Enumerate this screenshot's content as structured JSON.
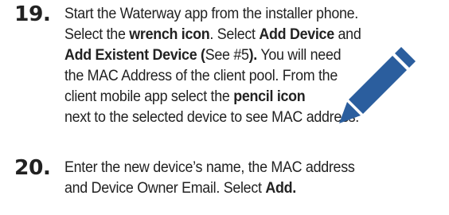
{
  "steps": [
    {
      "number": "19.",
      "lines": [
        [
          "Start the Waterway app from the installer phone."
        ],
        [
          "Select the ",
          "wrench icon",
          ". Select ",
          "Add Device",
          " and"
        ],
        [
          "Add Existent Device (",
          "See #5",
          ").",
          " You will need"
        ],
        [
          "the MAC Address of the client pool. From the"
        ],
        [
          "client mobile app select the ",
          "pencil icon"
        ],
        [
          "next to the selected device to see MAC address."
        ]
      ]
    },
    {
      "number": "20.",
      "lines": [
        [
          "Enter the new device’s name, the MAC address"
        ],
        [
          "and Device Owner Email. Select ",
          "Add."
        ]
      ]
    }
  ],
  "icons": {
    "pencil": "pencil-icon"
  },
  "colors": {
    "pencil": "#2b5e9e",
    "text": "#222222"
  }
}
